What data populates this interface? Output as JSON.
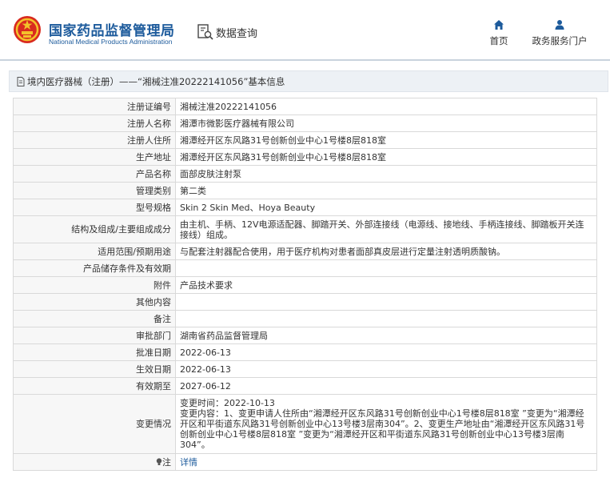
{
  "header": {
    "brand_cn": "国家药品监督管理局",
    "brand_en": "National Medical Products Administration",
    "query_label": "数据查询",
    "nav": [
      {
        "label": "首页",
        "icon": "home-icon"
      },
      {
        "label": "政务服务门户",
        "icon": "user-icon"
      }
    ]
  },
  "breadcrumb": {
    "text": "境内医疗器械（注册）——“湘械注准20222141056”基本信息"
  },
  "table": {
    "rows": [
      {
        "label": "注册证编号",
        "value": "湘械注准20222141056"
      },
      {
        "label": "注册人名称",
        "value": "湘潭市微影医疗器械有限公司"
      },
      {
        "label": "注册人住所",
        "value": "湘潭经开区东风路31号创新创业中心1号楼8层818室"
      },
      {
        "label": "生产地址",
        "value": "湘潭经开区东风路31号创新创业中心1号楼8层818室"
      },
      {
        "label": "产品名称",
        "value": "面部皮肤注射泵"
      },
      {
        "label": "管理类别",
        "value": "第二类"
      },
      {
        "label": "型号规格",
        "value": "Skin 2 Skin Med、Hoya Beauty"
      },
      {
        "label": "结构及组成/主要组成成分",
        "value": "由主机、手柄、12V电源适配器、脚踏开关、外部连接线（电源线、接地线、手柄连接线、脚踏板开关连接线）组成。"
      },
      {
        "label": "适用范围/预期用途",
        "value": "与配套注射器配合使用，用于医疗机构对患者面部真皮层进行定量注射透明质酸钠。"
      },
      {
        "label": "产品储存条件及有效期",
        "value": ""
      },
      {
        "label": "附件",
        "value": "产品技术要求"
      },
      {
        "label": "其他内容",
        "value": ""
      },
      {
        "label": "备注",
        "value": ""
      },
      {
        "label": "审批部门",
        "value": "湖南省药品监督管理局"
      },
      {
        "label": "批准日期",
        "value": "2022-06-13"
      },
      {
        "label": "生效日期",
        "value": "2022-06-13"
      },
      {
        "label": "有效期至",
        "value": "2027-06-12"
      },
      {
        "label": "变更情况",
        "value": "变更时间：2022-10-13\n变更内容：1、变更申请人住所由“湘潭经开区东风路31号创新创业中心1号楼8层818室 ”变更为“湘潭经开区和平街道东风路31号创新创业中心13号楼3层南304”。2、变更生产地址由“湘潭经开区东风路31号创新创业中心1号楼8层818室 ”变更为“湘潭经开区和平街道东风路31号创新创业中心13号楼3层南304”。"
      }
    ],
    "note": {
      "label": "注",
      "value": "详情"
    }
  },
  "colors": {
    "brand": "#1d5b9c",
    "label_bg": "#f7f7f7",
    "border": "#d9d9d9",
    "crumb_bg": "#edf1f5"
  }
}
